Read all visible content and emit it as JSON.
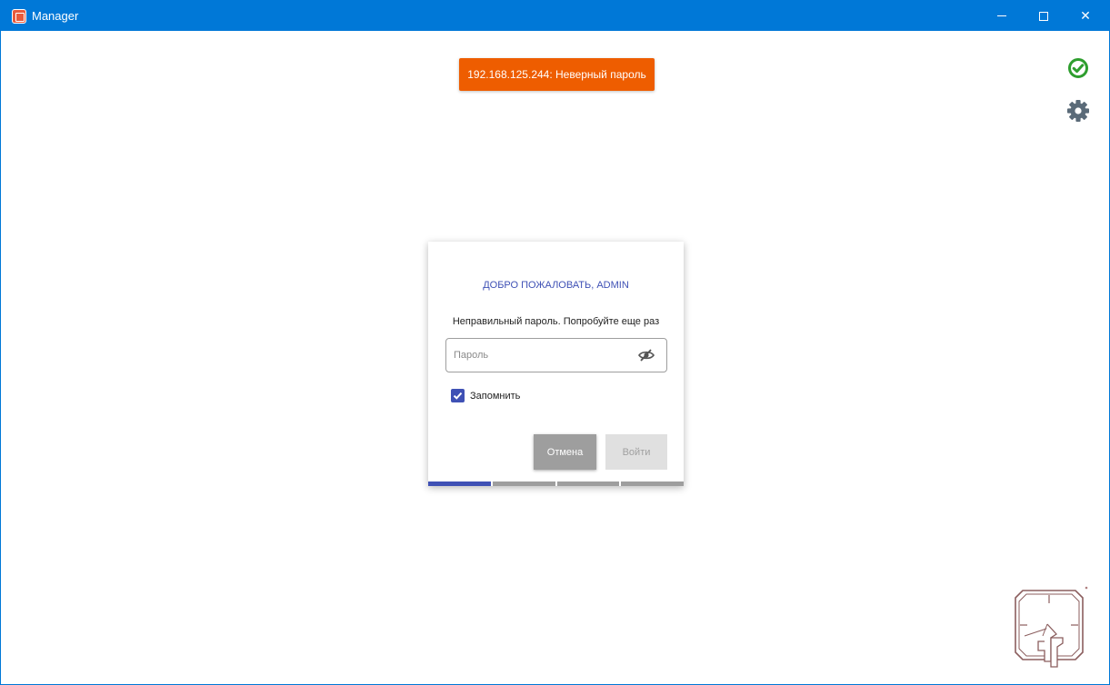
{
  "window": {
    "title": "Manager",
    "app_icon": "app-logo-icon"
  },
  "window_controls": {
    "minimize": "minimize-icon",
    "maximize": "maximize-icon",
    "close_glyph": "✕"
  },
  "toast": {
    "text": "192.168.125.244: Неверный пароль",
    "color": "#ee5d00"
  },
  "status": {
    "icon": "check-circle-icon",
    "color": "#2e9e2e"
  },
  "settings": {
    "icon": "gear-icon",
    "color": "#5a6a78"
  },
  "dialog": {
    "title": "ДОБРО ПОЖАЛОВАТЬ, ADMIN",
    "message": "Неправильный пароль. Попробуйте еще раз",
    "password": {
      "placeholder": "Пароль",
      "value": "",
      "icon": "eye-off-icon"
    },
    "remember": {
      "label": "Запомнить",
      "checked": true
    },
    "buttons": {
      "cancel": "Отмена",
      "login": "Войти"
    },
    "steps": {
      "total": 4,
      "active": 1
    }
  },
  "colors": {
    "titlebar": "#0078d7",
    "accent": "#3f51b5"
  }
}
